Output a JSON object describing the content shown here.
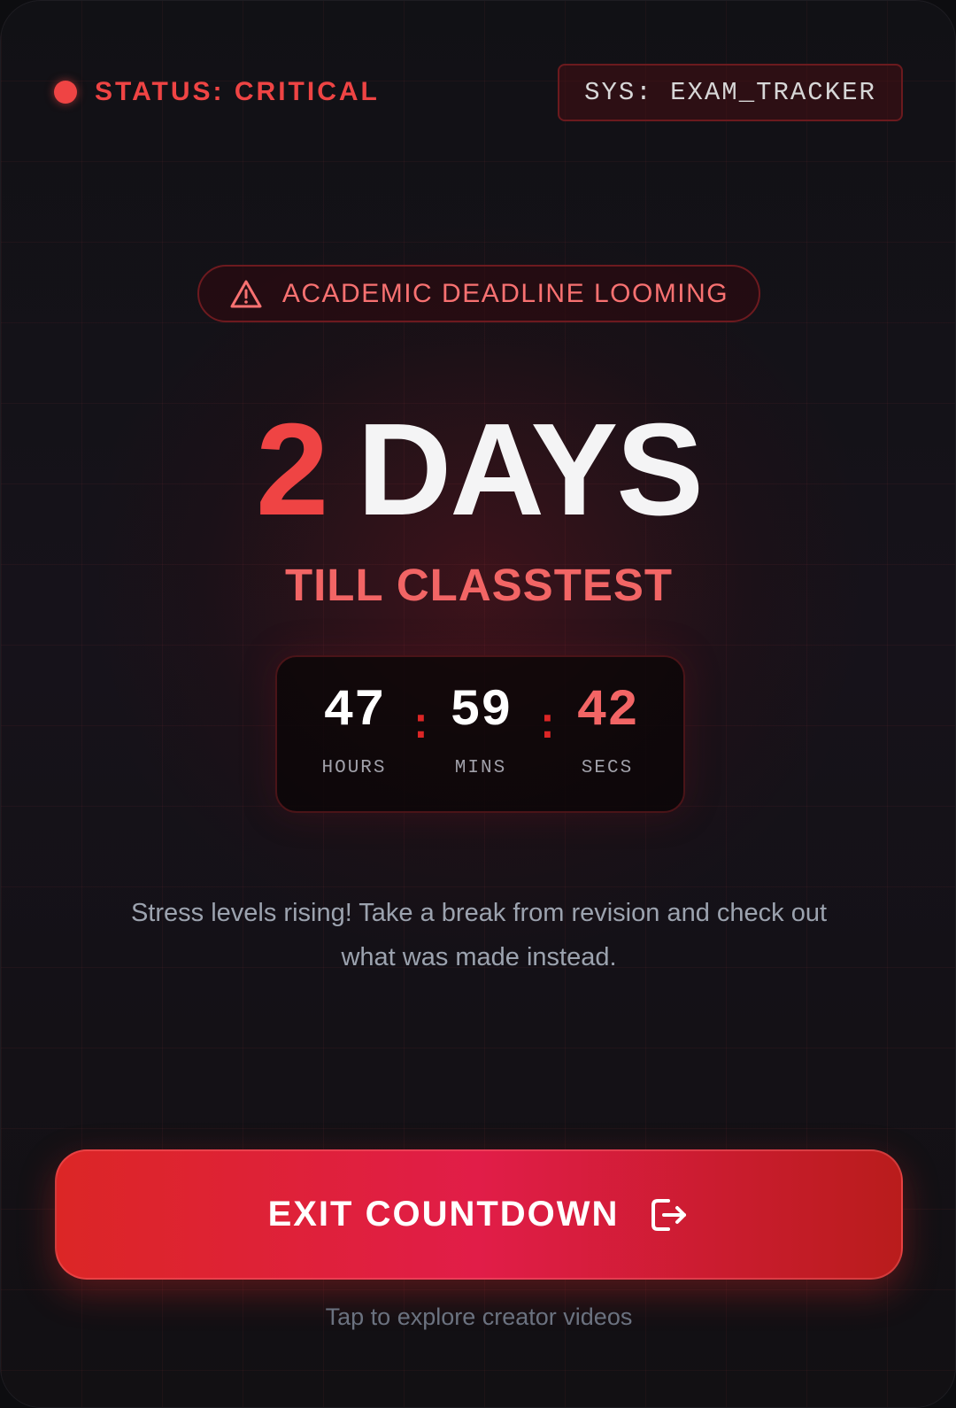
{
  "header": {
    "status_label": "STATUS: CRITICAL",
    "system_tag": "SYS: EXAM_TRACKER"
  },
  "alert": {
    "icon": "warning-triangle-icon",
    "label": "ACADEMIC DEADLINE LOOMING"
  },
  "headline": {
    "number": "2",
    "unit": "DAYS",
    "subtitle": "TILL CLASSTEST"
  },
  "countdown": {
    "hours": {
      "value": "47",
      "label": "HOURS"
    },
    "minutes": {
      "value": "59",
      "label": "MINS"
    },
    "seconds": {
      "value": "42",
      "label": "SECS"
    },
    "separator": ":"
  },
  "message": "Stress levels rising! Take a break from revision and check out what was made instead.",
  "cta": {
    "label": "EXIT COUNTDOWN",
    "icon": "exit-door-icon",
    "hint": "Tap to explore creator videos"
  },
  "colors": {
    "accent": "#ef4444",
    "background": "#111115",
    "button_gradient": [
      "#dc2626",
      "#e11d48",
      "#b91c1c"
    ]
  }
}
